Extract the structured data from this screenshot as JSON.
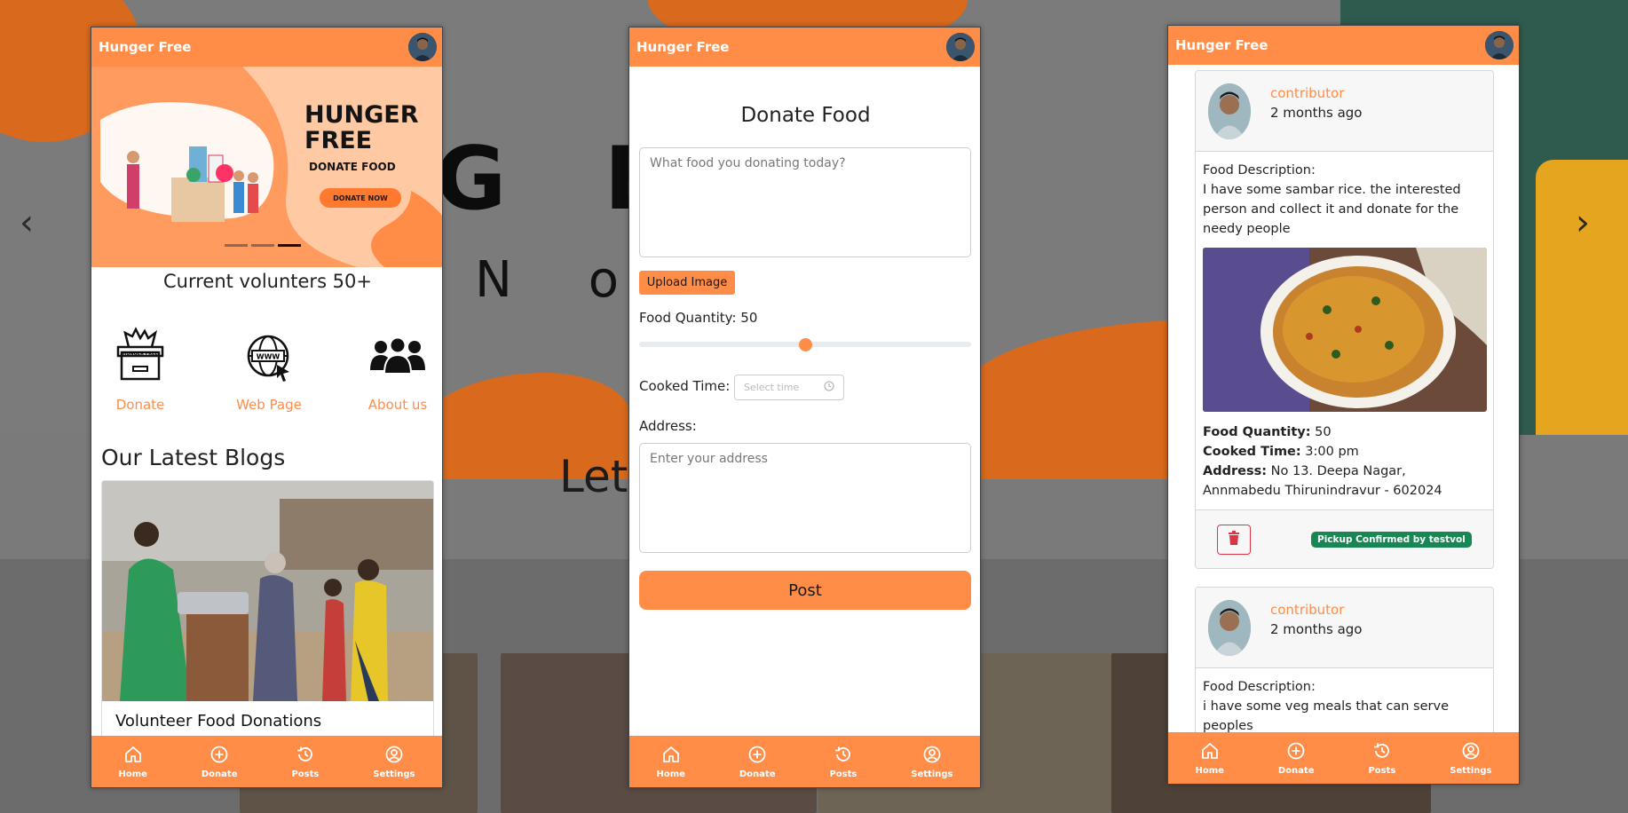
{
  "background": {
    "hero_big_text": "G E R   E",
    "hero_sub_text": "N o  T",
    "hero_tagline": "Let                              ger!",
    "prev_arrow": "‹",
    "next_arrow": "›"
  },
  "colors": {
    "accent": "#ff8c47",
    "success": "#198754",
    "danger": "#dc3545"
  },
  "app": {
    "title": "Hunger Free"
  },
  "home": {
    "banner": {
      "title_line1": "HUNGER",
      "title_line2": "FREE",
      "subtitle": "DONATE FOOD",
      "button_label": "DONATE NOW",
      "slide_count": 3,
      "active_slide": 3
    },
    "volunteers_text": "Current volunters 50+",
    "features": [
      {
        "label": "Donate",
        "icon": "donation-box-icon",
        "icon_text": "HUNGER FREE"
      },
      {
        "label": "Web Page",
        "icon": "globe-www-icon",
        "icon_text": "WWW"
      },
      {
        "label": "About us",
        "icon": "group-people-icon"
      }
    ],
    "blogs_heading": "Our Latest Blogs",
    "blog": {
      "title": "Volunteer Food Donations"
    }
  },
  "donate": {
    "title": "Donate Food",
    "food_placeholder": "What food you donating today?",
    "upload_label": "Upload Image",
    "quantity_label": "Food Quantity: 50",
    "quantity_value": 50,
    "quantity_max": 100,
    "cooked_time_label": "Cooked Time:",
    "time_placeholder": "Select time",
    "address_label": "Address:",
    "address_placeholder": "Enter your address",
    "post_label": "Post"
  },
  "posts": [
    {
      "author": "contributor",
      "time": "2 months ago",
      "description_label": "Food Description:",
      "description": "I have some sambar rice. the interested person and collect it and donate for the needy people",
      "quantity_label": "Food Quantity:",
      "quantity": "50",
      "cooked_label": "Cooked Time:",
      "cooked_time": "3:00 pm",
      "address_label": "Address:",
      "address": "No 13. Deepa Nagar, Annmabedu Thirunindravur - 602024",
      "status": "Pickup Confirmed by testvol"
    },
    {
      "author": "contributor",
      "time": "2 months ago",
      "description_label": "Food Description:",
      "description": "i have some veg meals that can serve peoples"
    }
  ],
  "nav": {
    "items": [
      {
        "label": "Home",
        "icon": "home-icon"
      },
      {
        "label": "Donate",
        "icon": "plus-circle-icon"
      },
      {
        "label": "Posts",
        "icon": "history-icon"
      },
      {
        "label": "Settings",
        "icon": "user-circle-icon"
      }
    ]
  }
}
